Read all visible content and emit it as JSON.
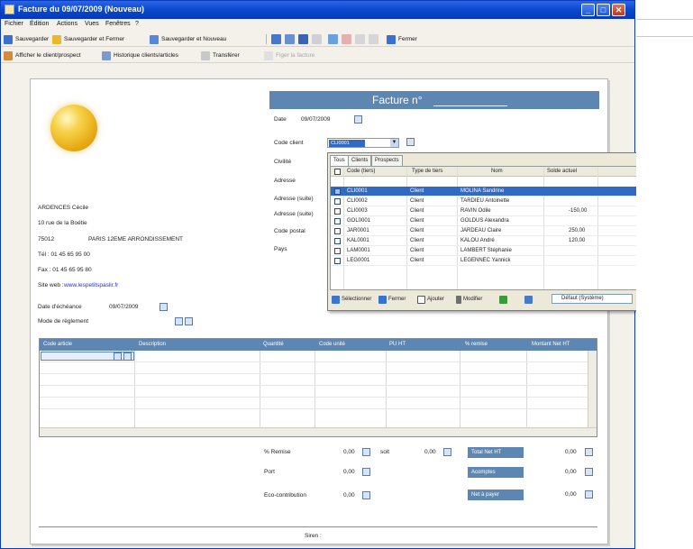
{
  "window": {
    "title": "Facture du 09/07/2009 (Nouveau)"
  },
  "menu": {
    "items": [
      "Fichier",
      "Édition",
      "Actions",
      "Vues",
      "Fenêtres",
      "?"
    ]
  },
  "toolbar1": {
    "save": "Sauvegarder",
    "save_close": "Sauvegarder et Fermer",
    "save_new": "Sauvegarder et Nouveau",
    "close": "Fermer"
  },
  "toolbar2": {
    "show_client": "Afficher le client/prospect",
    "history": "Historique clients/articles",
    "transfer": "Transférer",
    "lock": "Figer la facture"
  },
  "company": {
    "name": "ARDENCES Cécile",
    "street": "10 rue de la Boétie",
    "postal": "75012",
    "city": "PARIS 12EME ARRONDISSEMENT",
    "tel": "Tél : 01 45 65 95 00",
    "fax": "Fax : 01 45 65 95 80",
    "website_label": "Site web :",
    "website": "www.lespetitspaslir.fr"
  },
  "dates": {
    "echeance_label": "Date d'échéance",
    "echeance_value": "09/07/2009",
    "reglement_label": "Mode de règlement"
  },
  "facture": {
    "header": "Facture n°",
    "date_label": "Date",
    "date_value": "09/07/2009",
    "client_label": "Code client",
    "client_value": "CLI0001",
    "civilite_label": "Civilité",
    "adresse_label": "Adresse",
    "adresse_suite1_label": "Adresse (suite)",
    "adresse_suite2_label": "Adresse (suite)",
    "code_postal_label": "Code postal",
    "pays_label": "Pays"
  },
  "client_dropdown": {
    "tabs": [
      "Tous",
      "Clients",
      "Prospects"
    ],
    "columns": [
      "Code (tiers)",
      "Type de tiers",
      "Nom",
      "Solde actuel"
    ],
    "rows": [
      {
        "code": "CLI0001",
        "type": "Client",
        "nom": "MOLINA Sandrine",
        "solde": ""
      },
      {
        "code": "CLI0002",
        "type": "Client",
        "nom": "TARDIEU Antoinette",
        "solde": ""
      },
      {
        "code": "CLI0003",
        "type": "Client",
        "nom": "RAVIN Odile",
        "solde": "-150,00"
      },
      {
        "code": "GOL0001",
        "type": "Client",
        "nom": "GOLDUS Alexandra",
        "solde": ""
      },
      {
        "code": "JAR0001",
        "type": "Client",
        "nom": "JARDEAU Claire",
        "solde": "250,00"
      },
      {
        "code": "KAL0001",
        "type": "Client",
        "nom": "KALOU André",
        "solde": "120,00"
      },
      {
        "code": "LAM0001",
        "type": "Client",
        "nom": "LAMBERT Stéphanie",
        "solde": ""
      },
      {
        "code": "LEG0001",
        "type": "Client",
        "nom": "LEGENNEC Yannick",
        "solde": ""
      }
    ],
    "footer": {
      "select": "Sélectionner",
      "close": "Fermer",
      "add": "Ajouter",
      "modify": "Modifier",
      "view": "Défaut (Système)"
    }
  },
  "lines_table": {
    "columns": [
      "Code article",
      "Description",
      "Quantité",
      "Code unité",
      "PU HT",
      "% remise",
      "Montant Net HT"
    ]
  },
  "totals": {
    "remise_label": "% Remise",
    "remise_value": "0,00",
    "soit_label": "soit",
    "soit_value": "0,00",
    "port_label": "Port",
    "port_value": "0,00",
    "eco_label": "Eco-contribution",
    "eco_value": "0,00",
    "total_ht_label": "Total Net HT",
    "total_ht_value": "0,00",
    "acomptes_label": "Acomptes",
    "acomptes_value": "0,00",
    "net_label": "Net à payer",
    "net_value": "0,00"
  },
  "footer": {
    "siren": "Siren :"
  }
}
